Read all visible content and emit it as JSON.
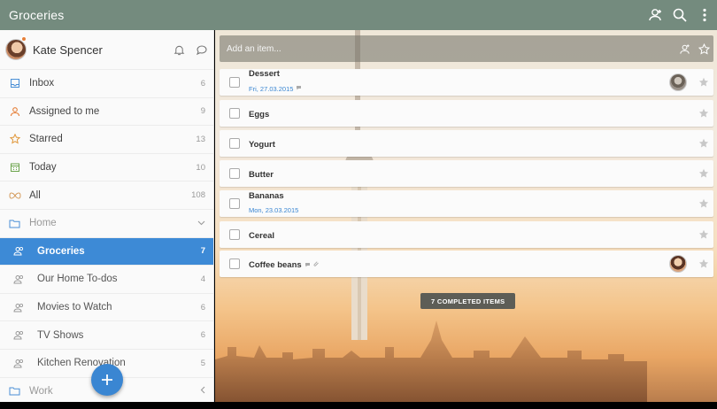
{
  "app": {
    "title": "Groceries"
  },
  "topbar": {
    "icons": [
      "add-member-icon",
      "search-icon",
      "more-vert-icon"
    ]
  },
  "profile": {
    "name": "Kate Spencer",
    "icons": [
      "bell-icon",
      "chat-icon"
    ]
  },
  "sidebar": {
    "items": [
      {
        "label": "Inbox",
        "count": "6",
        "icon": "inbox-icon",
        "kind": "smart"
      },
      {
        "label": "Assigned to me",
        "count": "9",
        "icon": "person-icon",
        "kind": "smart"
      },
      {
        "label": "Starred",
        "count": "13",
        "icon": "star-icon",
        "kind": "smart"
      },
      {
        "label": "Today",
        "count": "10",
        "icon": "calendar-icon",
        "kind": "smart"
      },
      {
        "label": "All",
        "count": "108",
        "icon": "infinity-icon",
        "kind": "smart"
      },
      {
        "label": "Home",
        "count": "",
        "icon": "folder-icon",
        "kind": "folder"
      },
      {
        "label": "Groceries",
        "count": "7",
        "icon": "people-icon",
        "kind": "list",
        "active": true
      },
      {
        "label": "Our Home To-dos",
        "count": "4",
        "icon": "people-icon",
        "kind": "list"
      },
      {
        "label": "Movies to Watch",
        "count": "6",
        "icon": "people-icon",
        "kind": "list"
      },
      {
        "label": "TV Shows",
        "count": "6",
        "icon": "people-icon",
        "kind": "list"
      },
      {
        "label": "Kitchen Renovation",
        "count": "5",
        "icon": "people-icon",
        "kind": "list"
      },
      {
        "label": "Work",
        "count": "",
        "icon": "folder-icon",
        "kind": "folder"
      }
    ]
  },
  "add_item": {
    "placeholder": "Add an item..."
  },
  "tasks": [
    {
      "name": "Dessert",
      "date": "Fri, 27.03.2015",
      "has_note": true,
      "assignee": true
    },
    {
      "name": "Eggs"
    },
    {
      "name": "Yogurt"
    },
    {
      "name": "Butter"
    },
    {
      "name": "Bananas",
      "date": "Mon, 23.03.2015"
    },
    {
      "name": "Cereal"
    },
    {
      "name": "Coffee beans",
      "has_note": true,
      "has_attachment": true,
      "assignee": true
    }
  ],
  "completed_label": "7 COMPLETED ITEMS",
  "colors": {
    "topbar": "#748b7e",
    "accent": "#3d8ad6",
    "fab": "#3a86d2"
  }
}
